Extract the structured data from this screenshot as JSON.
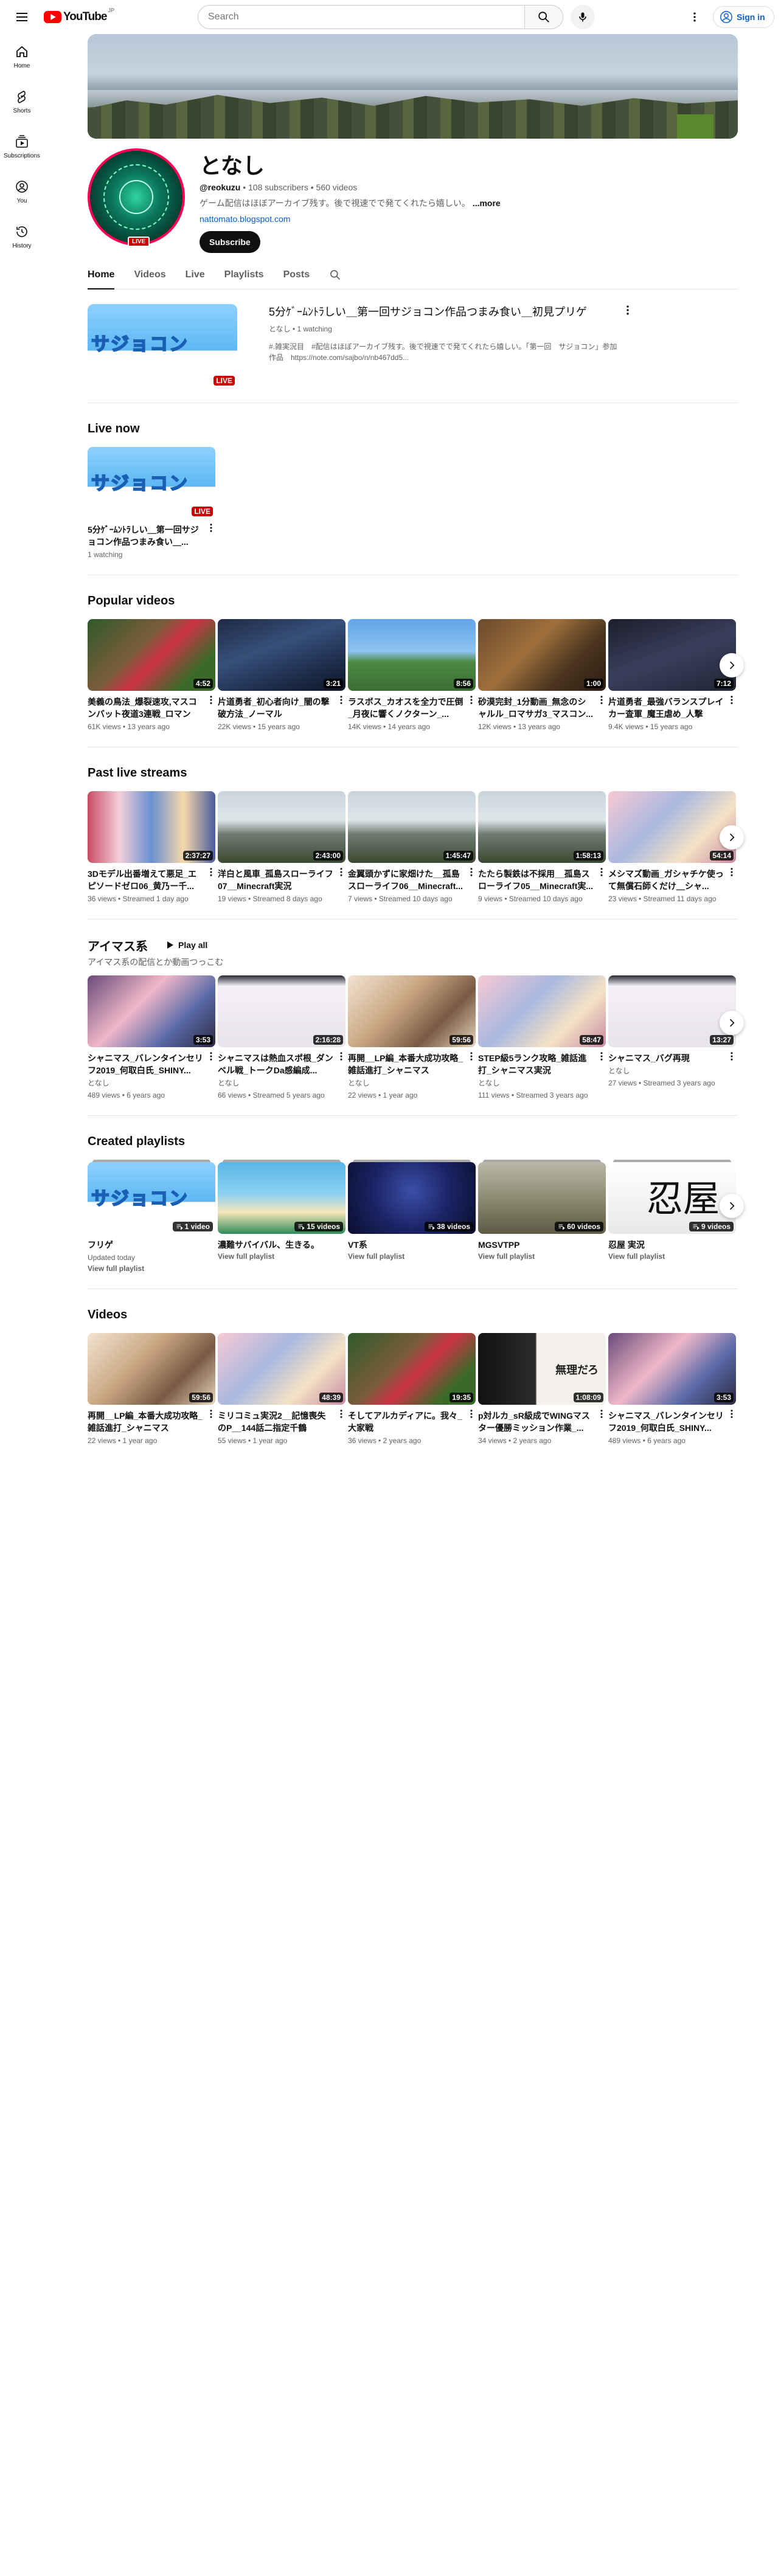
{
  "masthead": {
    "logo_text": "YouTube",
    "logo_region": "JP",
    "search_placeholder": "Search",
    "signin_label": "Sign in"
  },
  "sidebar": {
    "items": [
      {
        "label": "Home"
      },
      {
        "label": "Shorts"
      },
      {
        "label": "Subscriptions"
      },
      {
        "label": "You"
      },
      {
        "label": "History"
      }
    ]
  },
  "channel": {
    "title": "となし",
    "handle": "@reokuzu",
    "subscribers": "108 subscribers",
    "videos": "560 videos",
    "description": "ゲーム配信はほぼアーカイブ残す。後で視速でで発てくれたら嬉しい。",
    "more_label": "...more",
    "link": "nattomato.blogspot.com",
    "subscribe_label": "Subscribe",
    "live_badge": "LIVE"
  },
  "tabs": [
    {
      "label": "Home",
      "active": true
    },
    {
      "label": "Videos"
    },
    {
      "label": "Live"
    },
    {
      "label": "Playlists"
    },
    {
      "label": "Posts"
    }
  ],
  "featured": {
    "title": "5分ｹﾞｰﾑﾝﾄﾗしい＿第一回サジョコン作品つまみ食い＿初見プリゲ",
    "meta": "となし • 1 watching",
    "desc_line1": "#.雑実況目　#配信はほぼアーカイブ残す。後で視速でで発てくれたら嬉しい。「第一回　サジョコン」参加",
    "desc_line2": "作品　https://note.com/sajbo/n/nb467dd5...",
    "live_tag": "LIVE",
    "thumb_text": "サジョコン"
  },
  "live_now": {
    "title": "Live now",
    "card": {
      "title": "5分ｹﾞｰﾑﾝﾄﾗしい＿第一回サジョコン作品つまみ食い＿...",
      "meta": "1 watching",
      "live_tag": "LIVE",
      "thumb_text": "サジョコン"
    }
  },
  "popular": {
    "title": "Popular videos",
    "cards": [
      {
        "title": "美義の鳥法_爆裂速攻,マスコンバット夜道3連戦_ロマンサ...",
        "meta": "61K views • 13 years ago",
        "dur": "4:52",
        "art": "art-green"
      },
      {
        "title": "片道勇者_初心者向け_闇の撃破方法_ノーマル",
        "meta": "22K views • 15 years ago",
        "dur": "3:21",
        "art": "art-cave"
      },
      {
        "title": "ラスボス_カオスを全力で圧倒_月夜に響くノクターン_...",
        "meta": "14K views • 14 years ago",
        "dur": "8:56",
        "art": "art-sky"
      },
      {
        "title": "砂漠完封_1分動画_無念のシャルル_ロマサガ3_マスコン...",
        "meta": "12K views • 13 years ago",
        "dur": "1:00",
        "art": "art-mine"
      },
      {
        "title": "片道勇者_最強バランスプレイカー査軍_魔王虐め_人撃",
        "meta": "9.4K views • 15 years ago",
        "dur": "7:12",
        "art": "art-dark"
      }
    ]
  },
  "past_live": {
    "title": "Past live streams",
    "cards": [
      {
        "title": "3Dモデル出番増えて悪足_エピソードゼロ06_黄乃ー千...",
        "meta": "36 views • Streamed 1 day ago",
        "dur": "2:37:27",
        "art": "art-collage"
      },
      {
        "title": "洋白と風車_孤島スローライフ07__Minecraft実況",
        "meta": "19 views • Streamed 8 days ago",
        "dur": "2:43:00",
        "art": "art-sea"
      },
      {
        "title": "金翼頭かずに家畑けた__孤島スローライフ06__Minecraft...",
        "meta": "7 views • Streamed 10 days ago",
        "dur": "1:45:47",
        "art": "art-sea"
      },
      {
        "title": "たたら製鉄は不採用__孤島スローライフ05__Minecraft実...",
        "meta": "9 views • Streamed 10 days ago",
        "dur": "1:58:13",
        "art": "art-sea"
      },
      {
        "title": "メシマズ動画_ガシャチケ使って無償石師くだけ＿シャ...",
        "meta": "23 views • Streamed 11 days ago",
        "dur": "54:14",
        "art": "art-anime"
      }
    ]
  },
  "imas": {
    "title": "アイマス系",
    "play_all": "Play all",
    "subtitle": "アイマス系の配信とか動画つっこむ",
    "cards": [
      {
        "title": "シャニマス_バレンタインセリフ2019_何取白氏_SHINY...",
        "meta1": "となし",
        "meta2": "489 views • 6 years ago",
        "dur": "3:53",
        "art": "art-anime2"
      },
      {
        "title": "シャニマスは熱血スポ根_ダンベル戦_トークDa感編成...",
        "meta1": "となし",
        "meta2": "66 views • Streamed 5 years ago",
        "dur": "2:16:28",
        "art": "art-menu"
      },
      {
        "title": "再開__LP編_本番大成功攻略_雑話進打_シャニマス",
        "meta1": "となし",
        "meta2": "22 views • 1 year ago",
        "dur": "59:56",
        "art": "art-room"
      },
      {
        "title": "STEP級5ランク攻略_雑話進打_シャニマス実況",
        "meta1": "となし",
        "meta2": "111 views • Streamed 3 years ago",
        "dur": "58:47",
        "art": "art-anime"
      },
      {
        "title": "シャニマス_バグ再現",
        "meta1": "となし",
        "meta2": "27 views • Streamed 3 years ago",
        "dur": "13:27",
        "art": "art-menu"
      }
    ]
  },
  "playlists": {
    "title": "Created playlists",
    "cards": [
      {
        "title": "フリゲ",
        "meta1": "Updated today",
        "link": "View full playlist",
        "count": "1 video",
        "art": "art-sagicon",
        "thumb_text": "サジョコン"
      },
      {
        "title": "濃難サバイバル、生きる。",
        "meta1": "",
        "link": "View full playlist",
        "count": "15 videos",
        "art": "art-island",
        "thumb_text": ""
      },
      {
        "title": "VT系",
        "meta1": "",
        "link": "View full playlist",
        "count": "38 videos",
        "art": "art-space",
        "thumb_text": ""
      },
      {
        "title": "MGSVTPP",
        "meta1": "",
        "link": "View full playlist",
        "count": "60 videos",
        "art": "art-mech",
        "thumb_text": ""
      },
      {
        "title": "忍屋 実況",
        "meta1": "",
        "link": "View full playlist",
        "count": "9 videos",
        "art": "art-kanji",
        "thumb_text": "忍屋"
      }
    ]
  },
  "videos": {
    "title": "Videos",
    "cards": [
      {
        "title": "再開__LP編_本番大成功攻略_雑話進打_シャニマス",
        "meta": "22 views • 1 year ago",
        "dur": "59:56",
        "art": "art-room",
        "thumb_text": ""
      },
      {
        "title": "ミリコミュ実況2__記憶喪失のP__144話二指定千鶴",
        "meta": "55 views • 1 year ago",
        "dur": "48:39",
        "art": "art-anime",
        "thumb_text": ""
      },
      {
        "title": "そしてアルカディアに。我々_大家戦",
        "meta": "36 views • 2 years ago",
        "dur": "19:35",
        "art": "art-green",
        "thumb_text": ""
      },
      {
        "title": "p対ルカ_sR級成でWINGマスター優勝ミッション作業_...",
        "meta": "34 views • 2 years ago",
        "dur": "1:08:09",
        "art": "art-face",
        "thumb_text": "無理だろ"
      },
      {
        "title": "シャニマス_バレンタインセリフ2019_何取白氏_SHINY...",
        "meta": "489 views • 6 years ago",
        "dur": "3:53",
        "art": "art-anime2",
        "thumb_text": ""
      }
    ]
  }
}
